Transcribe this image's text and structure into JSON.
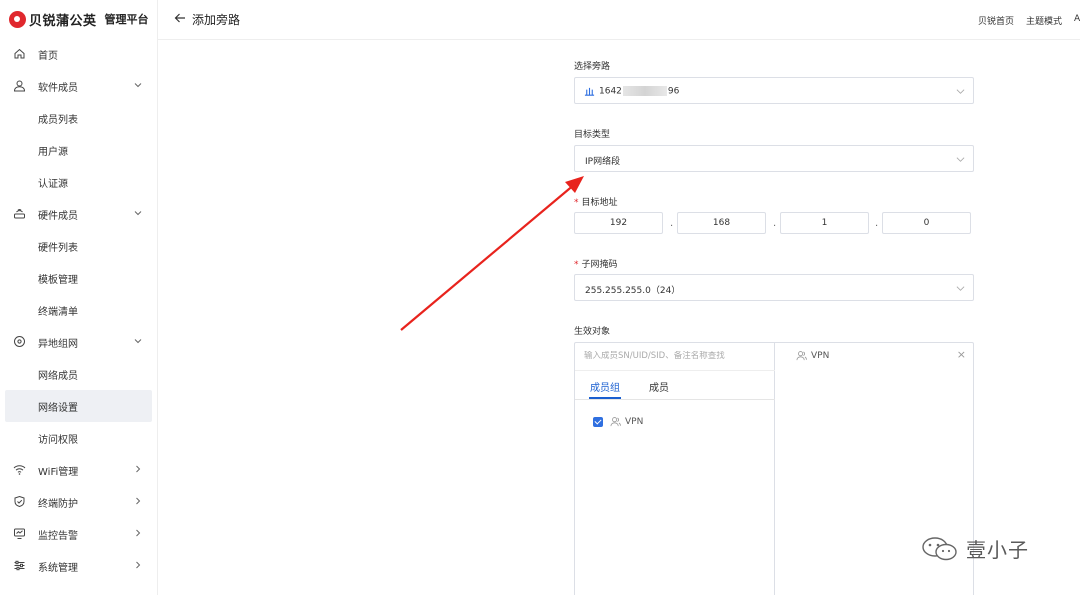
{
  "brand": {
    "name": "贝锐蒲公英",
    "sub": "管理平台"
  },
  "sidebar": {
    "items": [
      {
        "label": "首页",
        "icon": "home-icon",
        "type": "top"
      },
      {
        "label": "软件成员",
        "icon": "user-icon",
        "type": "top",
        "arrow": "down"
      },
      {
        "label": "成员列表",
        "type": "sub"
      },
      {
        "label": "用户源",
        "type": "sub"
      },
      {
        "label": "认证源",
        "type": "sub"
      },
      {
        "label": "硬件成员",
        "icon": "router-icon",
        "type": "top",
        "arrow": "down"
      },
      {
        "label": "硬件列表",
        "type": "sub"
      },
      {
        "label": "模板管理",
        "type": "sub"
      },
      {
        "label": "终端清单",
        "type": "sub"
      },
      {
        "label": "异地组网",
        "icon": "network-icon",
        "type": "top",
        "arrow": "down"
      },
      {
        "label": "网络成员",
        "type": "sub"
      },
      {
        "label": "网络设置",
        "type": "sub",
        "active": true
      },
      {
        "label": "访问权限",
        "type": "sub"
      },
      {
        "label": "WiFi管理",
        "icon": "wifi-icon",
        "type": "top",
        "arrow": "right"
      },
      {
        "label": "终端防护",
        "icon": "shield-icon",
        "type": "top",
        "arrow": "right"
      },
      {
        "label": "监控告警",
        "icon": "monitor-icon",
        "type": "top",
        "arrow": "right"
      },
      {
        "label": "系统管理",
        "icon": "settings-icon",
        "type": "top",
        "arrow": "right"
      }
    ]
  },
  "header": {
    "title": "添加旁路",
    "links": [
      "贝锐首页",
      "主题模式",
      "A"
    ]
  },
  "form": {
    "bypass": {
      "label": "选择旁路",
      "value_prefix": "1642",
      "value_suffix": "96"
    },
    "target_type": {
      "label": "目标类型",
      "value": "IP网络段"
    },
    "target_address": {
      "label": "目标地址",
      "octets": [
        "192",
        "168",
        "1",
        "0"
      ]
    },
    "subnet_mask": {
      "label": "子网掩码",
      "value": "255.255.255.0（24）"
    },
    "effective_target": {
      "label": "生效对象",
      "search_placeholder": "输入成员SN/UID/SID、备注名称查找",
      "tabs": [
        "成员组",
        "成员"
      ],
      "options": [
        {
          "label": "VPN",
          "checked": true
        }
      ],
      "selected": [
        {
          "label": "VPN"
        }
      ]
    }
  },
  "watermark": {
    "text": "壹小子"
  },
  "colors": {
    "brand": "#e0282e",
    "accent": "#1a5fd0",
    "arrow": "#e8231d"
  }
}
